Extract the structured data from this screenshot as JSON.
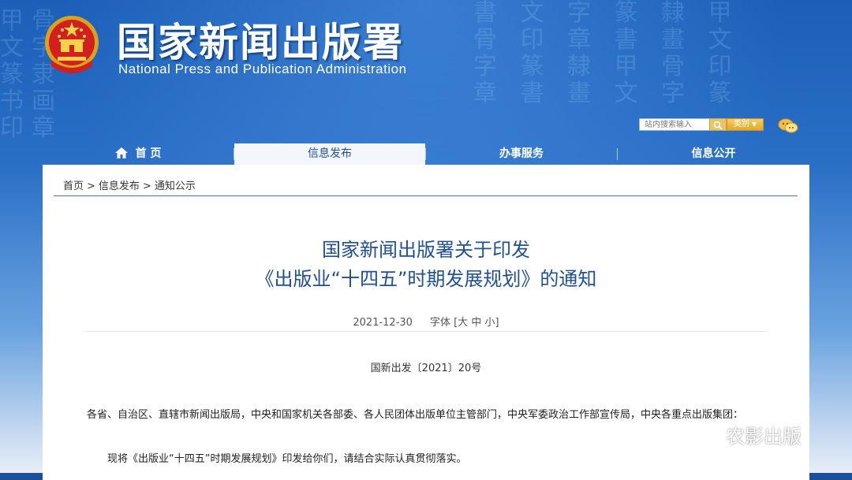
{
  "header": {
    "title": "国家新闻出版署",
    "subtitle": "National Press and Publication Administration",
    "search": {
      "placeholder": "站内搜索输入",
      "category_label": "类别"
    }
  },
  "nav": {
    "items": [
      {
        "label": "首 页"
      },
      {
        "label": "信息发布"
      },
      {
        "label": "办事服务"
      },
      {
        "label": "信息公开"
      }
    ]
  },
  "breadcrumb": {
    "home": "首页",
    "section": "信息发布",
    "page": "通知公示",
    "sep": ">"
  },
  "article": {
    "title_line1": "国家新闻出版署关于印发",
    "title_line2": "《出版业“十四五”时期发展规划》的通知",
    "date": "2021-12-30",
    "font_label": "字体",
    "font_open": "[",
    "font_large": "大",
    "font_medium": "中",
    "font_small": "小",
    "font_close": "]",
    "doc_number": "国新出发〔2021〕20号",
    "recipients": "各省、自治区、直辖市新闻出版局，中央和国家机关各部委、各人民团体出版单位主管部门，中央军委政治工作部宣传局，中央各重点出版集团：",
    "body": "现将《出版业“十四五”时期发展规划》印发给你们，请结合实际认真贯彻落实。"
  },
  "watermark": "农影出版",
  "colors": {
    "brand_blue": "#1f4f97",
    "header_blue": "#1b5fb8",
    "accent_gold": "#e2a92c"
  },
  "icons": [
    "national-emblem-icon",
    "search-icon",
    "chat-icon",
    "home-icon",
    "wechat-icon"
  ]
}
